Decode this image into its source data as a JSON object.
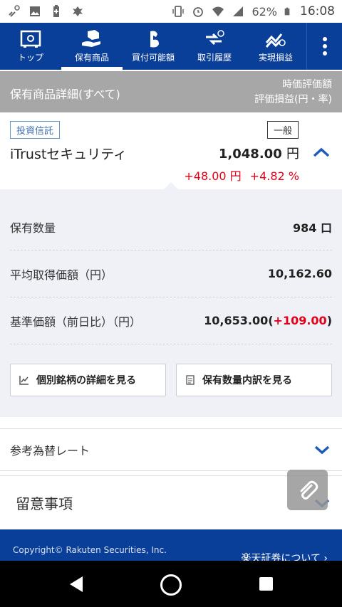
{
  "status_bar": {
    "battery": "62%",
    "time": "16:08"
  },
  "app_nav": {
    "items": [
      {
        "label": "トップ",
        "icon": "safe-icon"
      },
      {
        "label": "保有商品",
        "icon": "box-hand-icon"
      },
      {
        "label": "買付可能額",
        "icon": "arm-icon"
      },
      {
        "label": "取引履歴",
        "icon": "exchange-clock-icon"
      },
      {
        "label": "実現損益",
        "icon": "chart-clock-icon"
      }
    ],
    "active_index": 1
  },
  "section_header": {
    "title": "保有商品詳細(すべて)",
    "right_line1": "時価評価額",
    "right_line2": "評価損益(円・率)"
  },
  "product": {
    "category_badge": "投資信託",
    "account_badge": "一般",
    "name": "iTrustセキュリティ",
    "price": "1,048.00",
    "price_unit": "円",
    "change_amount": "+48.00 円",
    "change_rate": "+4.82 %"
  },
  "details": {
    "quantity_label": "保有数量",
    "quantity_value": "984 口",
    "avg_cost_label": "平均取得価額（円）",
    "avg_cost_value": "10,162.60",
    "base_price_label": "基準価額（前日比）（円）",
    "base_price_value": "10,653.00",
    "base_price_change_open": "(",
    "base_price_change": "+109.00",
    "base_price_change_close": ")",
    "button_detail": "個別銘柄の詳細を見る",
    "button_breakdown": "保有数量内訳を見る"
  },
  "accordions": {
    "fx_rate": "参考為替レート",
    "notes": "留意事項"
  },
  "footer": {
    "copyright": "Copyright© Rakuten Securities, Inc.",
    "about": "楽天証券について ›"
  },
  "colors": {
    "brand_blue": "#0a3f99",
    "positive_red": "#e2001a",
    "header_gray": "#a7a7a7",
    "panel_bg": "#eff1f7"
  }
}
